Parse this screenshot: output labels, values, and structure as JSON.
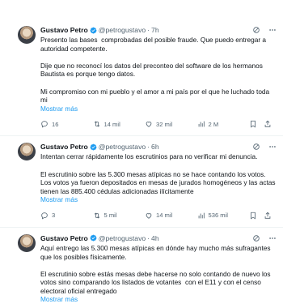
{
  "colors": {
    "accent": "#1d9bf0",
    "muted": "#536471",
    "text": "#0f1419",
    "verified": "#1d9bf0"
  },
  "tweets": [
    {
      "author": {
        "name": "Gustavo Petro",
        "handle": "@petrogustavo"
      },
      "sep": "·",
      "time": "7h",
      "paragraphs": [
        "Presento las bases  comprobadas del posible fraude. Que puedo entregar a autoridad competente.",
        "Dije que no reconocí los datos del preconteo del software de los hermanos Bautista es porque tengo datos.",
        "Mi compromiso con mi pueblo y el amor a mi país por el que he luchado toda mi"
      ],
      "show_more": "Mostrar más",
      "stats": {
        "replies": "16",
        "retweets": "14 mil",
        "likes": "32 mil",
        "views": "2 M"
      }
    },
    {
      "author": {
        "name": "Gustavo Petro",
        "handle": "@petrogustavo"
      },
      "sep": "·",
      "time": "6h",
      "paragraphs": [
        "Intentan cerrar rápidamente los escrutinios para no verificar mi denuncia.",
        "El escrutinio sobre las 5.300 mesas atípicas no se hace contando los votos. Los votos ya fueron depositados en mesas de jurados homogéneos y las actas tienen las 885.400 cédulas adicionadas ilícitamente"
      ],
      "show_more": "Mostrar más",
      "stats": {
        "replies": "3",
        "retweets": "5 mil",
        "likes": "14 mil",
        "views": "536 mil"
      }
    },
    {
      "author": {
        "name": "Gustavo Petro",
        "handle": "@petrogustavo"
      },
      "sep": "·",
      "time": "4h",
      "paragraphs": [
        "Aquí entrego las 5.300 mesas atípicas en dónde hay mucho más sufragantes que los posibles físicamente.",
        "El escrutinio sobre estás mesas debe hacerse no solo contando de nuevo los votos sino comparando los listados de votantes  con el E11 y con el censo electoral oficial entregado"
      ],
      "show_more": "Mostrar más"
    }
  ]
}
